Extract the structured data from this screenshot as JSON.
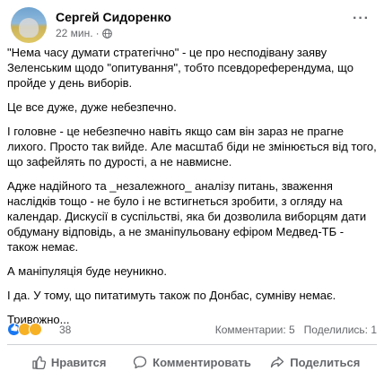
{
  "post": {
    "author": "Сергей Сидоренко",
    "time": "22 мин.",
    "separator": "·",
    "more": "···",
    "paragraphs": [
      "\"Нема часу думати стратегічно\" - це про несподівану заяву Зеленським щодо \"опитування\", тобто псевдореферендума, що пройде у день виборів.",
      "Це все дуже, дуже небезпечно.",
      "І головне - це небезпечно навіть якщо сам він зараз не прагне лихого. Просто так вийде. Але масштаб біди не змінюється від того, що зафейлять по дурості, а не навмисне.",
      "Адже надійного та _незалежного_ аналізу питань, зваження наслідків тощо - не було і не встигнеться зробити, з огляду на календар. Дискусії в суспільстві, яка би дозволила виборцям дати обдуману відповідь, а не зманіпульовану ефіром Медвед-ТБ - також немає.",
      "А маніпуляція буде неуникно.",
      "І да. У тому, що питатимуть також по Донбас, сумніву немає.",
      "Тривожно..."
    ]
  },
  "reactions": {
    "count": "38",
    "icons": [
      "like-reaction-icon",
      "wow-reaction-icon",
      "sad-reaction-icon"
    ],
    "comments": "Комментарии: 5",
    "shares": "Поделились: 1"
  },
  "actions": {
    "like": "Нравится",
    "comment": "Комментировать",
    "share": "Поделиться"
  },
  "colors": {
    "text": "#050505",
    "secondary": "#65676b",
    "like_blue": "#1877f2",
    "reaction_yellow": "#f7b125"
  }
}
